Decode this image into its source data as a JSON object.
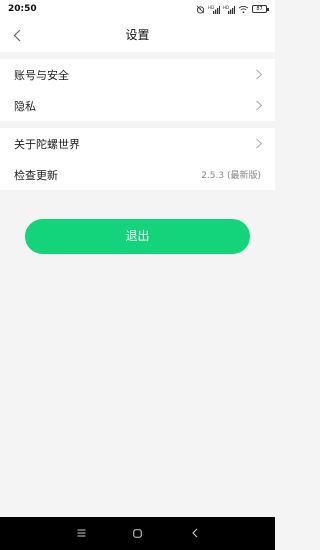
{
  "status_bar": {
    "time": "20:50",
    "battery": "87",
    "icons": [
      "alarm-icon",
      "signal-hd-icon",
      "signal-hd-icon",
      "wifi-icon",
      "battery-icon"
    ]
  },
  "header": {
    "title": "设置",
    "back_icon": "chevron-left-icon"
  },
  "groups": [
    {
      "items": [
        {
          "label": "账号与安全",
          "has_chevron": true
        },
        {
          "label": "隐私",
          "has_chevron": true
        }
      ]
    },
    {
      "items": [
        {
          "label": "关于陀螺世界",
          "has_chevron": true
        },
        {
          "label": "检查更新",
          "value": "2.5.3 (最新版)"
        }
      ]
    }
  ],
  "logout_button": {
    "label": "退出",
    "color": "#13d47a"
  },
  "nav_bar": {
    "icons": [
      "menu-icon",
      "home-icon",
      "back-icon"
    ]
  }
}
